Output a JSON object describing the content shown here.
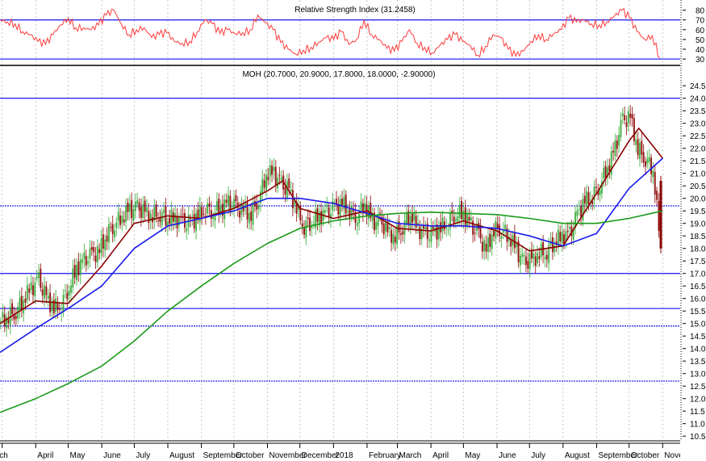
{
  "chart_data": [
    {
      "type": "line",
      "title": "Relative Strength Index (31.2458)",
      "ylim": [
        25,
        85
      ],
      "yticks": [
        30,
        40,
        50,
        60,
        70,
        80
      ],
      "reference_lines": [
        70,
        30
      ],
      "colors": {
        "rsi": "#ff3b3b",
        "reference": "#2a2aee"
      },
      "grid": "vertical dotted at months",
      "rsi": [
        70,
        68,
        66,
        58,
        55,
        48,
        45,
        55,
        65,
        72,
        62,
        62,
        60,
        65,
        75,
        80,
        66,
        55,
        60,
        62,
        52,
        55,
        57,
        48,
        46,
        48,
        58,
        70,
        66,
        56,
        60,
        56,
        57,
        60,
        75,
        67,
        60,
        47,
        40,
        35,
        39,
        42,
        47,
        52,
        50,
        58,
        45,
        50,
        70,
        55,
        50,
        41,
        38,
        48,
        60,
        46,
        42,
        36,
        44,
        50,
        55,
        48,
        44,
        34,
        43,
        55,
        52,
        40,
        33,
        38,
        48,
        55,
        50,
        56,
        60,
        72,
        68,
        70,
        66,
        65,
        68,
        74,
        80,
        72,
        58,
        50,
        54,
        31
      ]
    },
    {
      "type": "candlestick",
      "title": "MOH (20.7000, 20.9000, 17.8000, 18.0000, -2.90000)",
      "ylim": [
        10.3,
        24.8
      ],
      "yticks": [
        "24.5",
        "24.0",
        "23.5",
        "23.0",
        "22.5",
        "22.0",
        "21.5",
        "21.0",
        "20.5",
        "20.0",
        "19.5",
        "19.0",
        "18.5",
        "18.0",
        "17.5",
        "17.0",
        "16.5",
        "16.0",
        "15.5",
        "15.0",
        "14.5",
        "14.0",
        "13.5",
        "13.0",
        "12.5",
        "12.0",
        "11.5",
        "11.0",
        "10.5"
      ],
      "x_tick_labels": [
        {
          "date": "2017-03-01",
          "label": "March"
        },
        {
          "date": "2017-04-01",
          "label": "April"
        },
        {
          "date": "2017-05-01",
          "label": "May"
        },
        {
          "date": "2017-06-01",
          "label": "June"
        },
        {
          "date": "2017-07-01",
          "label": "July"
        },
        {
          "date": "2017-08-01",
          "label": "August"
        },
        {
          "date": "2017-09-01",
          "label": "September"
        },
        {
          "date": "2017-10-01",
          "label": "October"
        },
        {
          "date": "2017-11-01",
          "label": "November"
        },
        {
          "date": "2017-12-01",
          "label": "December"
        },
        {
          "date": "2018-01-01",
          "label": "2018"
        },
        {
          "date": "2018-02-01",
          "label": "February"
        },
        {
          "date": "2018-03-01",
          "label": "March"
        },
        {
          "date": "2018-04-01",
          "label": "April"
        },
        {
          "date": "2018-05-01",
          "label": "May"
        },
        {
          "date": "2018-06-01",
          "label": "June"
        },
        {
          "date": "2018-07-01",
          "label": "July"
        },
        {
          "date": "2018-08-01",
          "label": "August"
        },
        {
          "date": "2018-09-01",
          "label": "September"
        },
        {
          "date": "2018-10-01",
          "label": "October"
        },
        {
          "date": "2018-11-01",
          "label": "November"
        }
      ],
      "weekly_close_start": "2017-02-27",
      "weekly_close": [
        15.1,
        15.3,
        15.5,
        16.0,
        16.4,
        16.7,
        16.0,
        15.6,
        15.8,
        16.5,
        17.2,
        17.5,
        17.7,
        17.9,
        18.6,
        19.0,
        19.3,
        19.5,
        19.6,
        19.4,
        19.3,
        19.4,
        19.2,
        19.2,
        19.0,
        19.0,
        19.3,
        19.6,
        19.5,
        19.6,
        19.8,
        19.6,
        19.5,
        19.4,
        20.0,
        21.0,
        21.0,
        20.5,
        20.3,
        19.6,
        18.9,
        19.1,
        19.3,
        19.4,
        19.6,
        19.8,
        19.5,
        19.3,
        19.8,
        19.0,
        19.1,
        18.6,
        18.5,
        18.9,
        19.4,
        18.8,
        18.5,
        18.6,
        18.8,
        19.1,
        19.4,
        19.4,
        18.9,
        18.5,
        17.9,
        18.8,
        18.8,
        18.5,
        17.9,
        17.4,
        17.5,
        17.8,
        17.9,
        18.3,
        18.5,
        18.5,
        19.3,
        19.9,
        20.1,
        20.6,
        21.2,
        22.0,
        23.1,
        23.2,
        22.0,
        21.6,
        21.2,
        18.0
      ],
      "last_bar": {
        "open": 20.7,
        "high": 20.9,
        "low": 17.8,
        "close": 18.0,
        "change": -2.9
      },
      "moving_averages": [
        {
          "color": "#8b0000",
          "points": [
            [
              "2017-02-27",
              15.0
            ],
            [
              "2017-04-01",
              15.9
            ],
            [
              "2017-05-01",
              15.8
            ],
            [
              "2017-06-01",
              17.3
            ],
            [
              "2017-07-01",
              19.0
            ],
            [
              "2017-08-01",
              19.3
            ],
            [
              "2017-09-01",
              19.2
            ],
            [
              "2017-10-01",
              19.6
            ],
            [
              "2017-11-01",
              20.3
            ],
            [
              "2017-11-15",
              20.7
            ],
            [
              "2017-12-01",
              19.6
            ],
            [
              "2018-01-01",
              19.2
            ],
            [
              "2018-02-01",
              19.5
            ],
            [
              "2018-03-01",
              18.8
            ],
            [
              "2018-04-01",
              18.7
            ],
            [
              "2018-05-01",
              19.1
            ],
            [
              "2018-06-01",
              18.7
            ],
            [
              "2018-07-01",
              17.9
            ],
            [
              "2018-08-01",
              18.1
            ],
            [
              "2018-09-01",
              20.2
            ],
            [
              "2018-10-01",
              22.3
            ],
            [
              "2018-10-10",
              22.8
            ],
            [
              "2018-11-01",
              21.6
            ]
          ]
        },
        {
          "color": "#1a1aee",
          "points": [
            [
              "2017-02-27",
              13.85
            ],
            [
              "2017-04-01",
              14.8
            ],
            [
              "2017-05-01",
              15.6
            ],
            [
              "2017-06-01",
              16.5
            ],
            [
              "2017-07-01",
              18.0
            ],
            [
              "2017-08-01",
              18.9
            ],
            [
              "2017-09-01",
              19.2
            ],
            [
              "2017-10-01",
              19.5
            ],
            [
              "2017-11-01",
              20.0
            ],
            [
              "2017-12-01",
              20.0
            ],
            [
              "2018-01-01",
              19.8
            ],
            [
              "2018-02-01",
              19.4
            ],
            [
              "2018-03-01",
              19.0
            ],
            [
              "2018-04-01",
              18.9
            ],
            [
              "2018-05-01",
              18.9
            ],
            [
              "2018-06-01",
              18.8
            ],
            [
              "2018-07-01",
              18.5
            ],
            [
              "2018-08-01",
              18.1
            ],
            [
              "2018-09-01",
              18.6
            ],
            [
              "2018-10-01",
              20.4
            ],
            [
              "2018-11-01",
              21.6
            ]
          ]
        },
        {
          "color": "#1a9a1a",
          "points": [
            [
              "2017-02-27",
              11.45
            ],
            [
              "2017-04-01",
              12.0
            ],
            [
              "2017-05-01",
              12.6
            ],
            [
              "2017-06-01",
              13.3
            ],
            [
              "2017-07-01",
              14.3
            ],
            [
              "2017-08-01",
              15.5
            ],
            [
              "2017-09-01",
              16.5
            ],
            [
              "2017-10-01",
              17.4
            ],
            [
              "2017-11-01",
              18.2
            ],
            [
              "2017-12-01",
              18.8
            ],
            [
              "2018-01-01",
              19.1
            ],
            [
              "2018-02-01",
              19.3
            ],
            [
              "2018-03-01",
              19.4
            ],
            [
              "2018-04-01",
              19.45
            ],
            [
              "2018-05-01",
              19.4
            ],
            [
              "2018-06-01",
              19.35
            ],
            [
              "2018-07-01",
              19.2
            ],
            [
              "2018-08-01",
              19.0
            ],
            [
              "2018-09-01",
              19.0
            ],
            [
              "2018-10-01",
              19.2
            ],
            [
              "2018-11-01",
              19.5
            ]
          ]
        }
      ],
      "horizontal_lines": [
        {
          "value": 24.0,
          "style": "solid"
        },
        {
          "value": 19.7,
          "style": "dotted"
        },
        {
          "value": 17.0,
          "style": "solid"
        },
        {
          "value": 15.6,
          "style": "solid"
        },
        {
          "value": 14.9,
          "style": "dotted"
        },
        {
          "value": 12.7,
          "style": "dotted"
        }
      ],
      "colors": {
        "up": "#33aa33",
        "down": "#8b0000",
        "hline": "#2a2aee"
      }
    }
  ]
}
